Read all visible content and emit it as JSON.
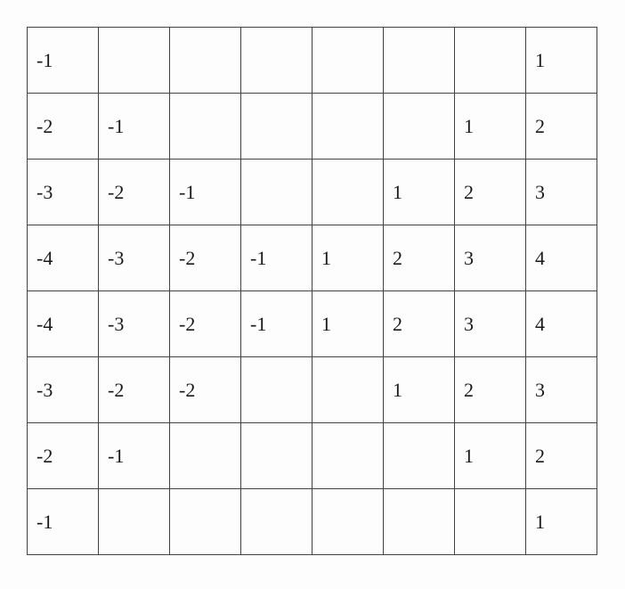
{
  "chart_data": {
    "type": "table",
    "rows": [
      [
        "-1",
        "",
        "",
        "",
        "",
        "",
        "",
        "1"
      ],
      [
        "-2",
        "-1",
        "",
        "",
        "",
        "",
        "1",
        "2"
      ],
      [
        "-3",
        "-2",
        "-1",
        "",
        "",
        "1",
        "2",
        "3"
      ],
      [
        "-4",
        "-3",
        "-2",
        "-1",
        "1",
        "2",
        "3",
        "4"
      ],
      [
        "-4",
        "-3",
        "-2",
        "-1",
        "1",
        "2",
        "3",
        "4"
      ],
      [
        "-3",
        "-2",
        "-2",
        "",
        "",
        "1",
        "2",
        "3"
      ],
      [
        "-2",
        "-1",
        "",
        "",
        "",
        "",
        "1",
        "2"
      ],
      [
        "-1",
        "",
        "",
        "",
        "",
        "",
        "",
        "1"
      ]
    ]
  }
}
